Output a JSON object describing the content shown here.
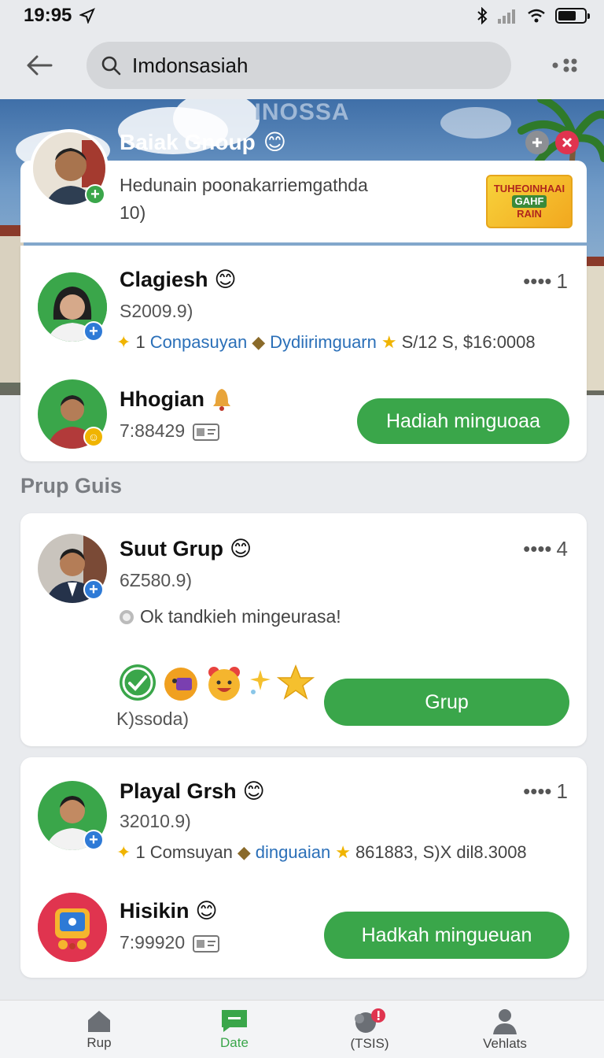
{
  "status_bar": {
    "time": "19:95"
  },
  "search": {
    "value": "Imdonsasiah"
  },
  "banner": {
    "title": "INOSSA"
  },
  "header_group": {
    "name": "Baiak Gnoup",
    "description_line1": "Hedunain poonakarriemgathda",
    "description_line2": "10)",
    "promo_lines": [
      "TUHEOINHAAI",
      "GAHF",
      "RAIN"
    ]
  },
  "card1": {
    "row1": {
      "name": "Clagiesh",
      "sub": "S2009.9)",
      "count": "1",
      "meta_num": "1",
      "meta_blue1": "Conpasuyan",
      "meta_blue2": "Dydiirimguarn",
      "meta_tail": "S/12 S, $16:0008"
    },
    "row2": {
      "name": "Hhogian",
      "sub": "7:88429",
      "button": "Hadiah minguoaa"
    }
  },
  "section_title": "Prup Guis",
  "card2": {
    "name": "Suut Grup",
    "sub": "6Z580.9)",
    "count": "4",
    "message": "Ok tandkieh mingeurasa!",
    "reaction_label": "K)ssoda)",
    "button": "Grup"
  },
  "card3": {
    "row1": {
      "name": "Playal Grsh",
      "sub": "32010.9)",
      "count": "1",
      "meta_num": "1",
      "meta_text": "Comsuyan",
      "meta_blue": "dinguaian",
      "meta_tail": "861883, S)X dil8.3008"
    },
    "row2": {
      "name": "Hisikin",
      "sub": "7:99920",
      "button": "Hadkah mingueuan"
    }
  },
  "bottom_nav": [
    {
      "label": "Rup",
      "icon": "home-icon"
    },
    {
      "label": "Date",
      "icon": "chat-icon"
    },
    {
      "label": "(TSIS)",
      "icon": "notification-icon"
    },
    {
      "label": "Vehlats",
      "icon": "profile-icon"
    }
  ],
  "colors": {
    "accent_green": "#3aa64a",
    "link_blue": "#2a6fb8",
    "badge_blue": "#2e7ad6",
    "close_red": "#e0344f"
  }
}
